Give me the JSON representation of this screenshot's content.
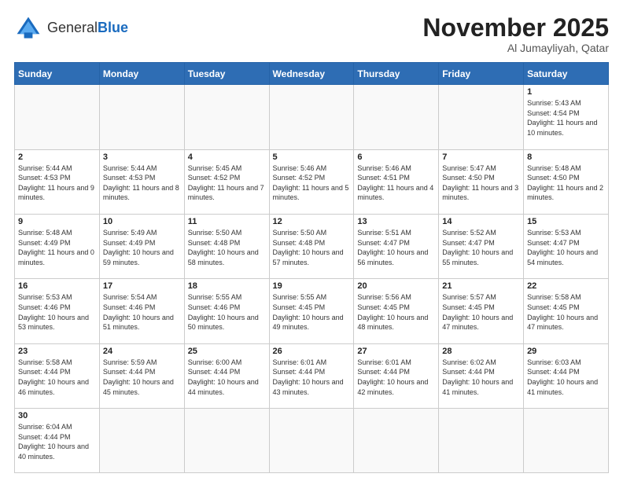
{
  "header": {
    "logo_general": "General",
    "logo_blue": "Blue",
    "month_title": "November 2025",
    "location": "Al Jumayliyah, Qatar"
  },
  "weekdays": [
    "Sunday",
    "Monday",
    "Tuesday",
    "Wednesday",
    "Thursday",
    "Friday",
    "Saturday"
  ],
  "weeks": [
    [
      {
        "day": "",
        "info": ""
      },
      {
        "day": "",
        "info": ""
      },
      {
        "day": "",
        "info": ""
      },
      {
        "day": "",
        "info": ""
      },
      {
        "day": "",
        "info": ""
      },
      {
        "day": "",
        "info": ""
      },
      {
        "day": "1",
        "info": "Sunrise: 5:43 AM\nSunset: 4:54 PM\nDaylight: 11 hours and 10 minutes."
      }
    ],
    [
      {
        "day": "2",
        "info": "Sunrise: 5:44 AM\nSunset: 4:53 PM\nDaylight: 11 hours and 9 minutes."
      },
      {
        "day": "3",
        "info": "Sunrise: 5:44 AM\nSunset: 4:53 PM\nDaylight: 11 hours and 8 minutes."
      },
      {
        "day": "4",
        "info": "Sunrise: 5:45 AM\nSunset: 4:52 PM\nDaylight: 11 hours and 7 minutes."
      },
      {
        "day": "5",
        "info": "Sunrise: 5:46 AM\nSunset: 4:52 PM\nDaylight: 11 hours and 5 minutes."
      },
      {
        "day": "6",
        "info": "Sunrise: 5:46 AM\nSunset: 4:51 PM\nDaylight: 11 hours and 4 minutes."
      },
      {
        "day": "7",
        "info": "Sunrise: 5:47 AM\nSunset: 4:50 PM\nDaylight: 11 hours and 3 minutes."
      },
      {
        "day": "8",
        "info": "Sunrise: 5:48 AM\nSunset: 4:50 PM\nDaylight: 11 hours and 2 minutes."
      }
    ],
    [
      {
        "day": "9",
        "info": "Sunrise: 5:48 AM\nSunset: 4:49 PM\nDaylight: 11 hours and 0 minutes."
      },
      {
        "day": "10",
        "info": "Sunrise: 5:49 AM\nSunset: 4:49 PM\nDaylight: 10 hours and 59 minutes."
      },
      {
        "day": "11",
        "info": "Sunrise: 5:50 AM\nSunset: 4:48 PM\nDaylight: 10 hours and 58 minutes."
      },
      {
        "day": "12",
        "info": "Sunrise: 5:50 AM\nSunset: 4:48 PM\nDaylight: 10 hours and 57 minutes."
      },
      {
        "day": "13",
        "info": "Sunrise: 5:51 AM\nSunset: 4:47 PM\nDaylight: 10 hours and 56 minutes."
      },
      {
        "day": "14",
        "info": "Sunrise: 5:52 AM\nSunset: 4:47 PM\nDaylight: 10 hours and 55 minutes."
      },
      {
        "day": "15",
        "info": "Sunrise: 5:53 AM\nSunset: 4:47 PM\nDaylight: 10 hours and 54 minutes."
      }
    ],
    [
      {
        "day": "16",
        "info": "Sunrise: 5:53 AM\nSunset: 4:46 PM\nDaylight: 10 hours and 53 minutes."
      },
      {
        "day": "17",
        "info": "Sunrise: 5:54 AM\nSunset: 4:46 PM\nDaylight: 10 hours and 51 minutes."
      },
      {
        "day": "18",
        "info": "Sunrise: 5:55 AM\nSunset: 4:46 PM\nDaylight: 10 hours and 50 minutes."
      },
      {
        "day": "19",
        "info": "Sunrise: 5:55 AM\nSunset: 4:45 PM\nDaylight: 10 hours and 49 minutes."
      },
      {
        "day": "20",
        "info": "Sunrise: 5:56 AM\nSunset: 4:45 PM\nDaylight: 10 hours and 48 minutes."
      },
      {
        "day": "21",
        "info": "Sunrise: 5:57 AM\nSunset: 4:45 PM\nDaylight: 10 hours and 47 minutes."
      },
      {
        "day": "22",
        "info": "Sunrise: 5:58 AM\nSunset: 4:45 PM\nDaylight: 10 hours and 47 minutes."
      }
    ],
    [
      {
        "day": "23",
        "info": "Sunrise: 5:58 AM\nSunset: 4:44 PM\nDaylight: 10 hours and 46 minutes."
      },
      {
        "day": "24",
        "info": "Sunrise: 5:59 AM\nSunset: 4:44 PM\nDaylight: 10 hours and 45 minutes."
      },
      {
        "day": "25",
        "info": "Sunrise: 6:00 AM\nSunset: 4:44 PM\nDaylight: 10 hours and 44 minutes."
      },
      {
        "day": "26",
        "info": "Sunrise: 6:01 AM\nSunset: 4:44 PM\nDaylight: 10 hours and 43 minutes."
      },
      {
        "day": "27",
        "info": "Sunrise: 6:01 AM\nSunset: 4:44 PM\nDaylight: 10 hours and 42 minutes."
      },
      {
        "day": "28",
        "info": "Sunrise: 6:02 AM\nSunset: 4:44 PM\nDaylight: 10 hours and 41 minutes."
      },
      {
        "day": "29",
        "info": "Sunrise: 6:03 AM\nSunset: 4:44 PM\nDaylight: 10 hours and 41 minutes."
      }
    ],
    [
      {
        "day": "30",
        "info": "Sunrise: 6:04 AM\nSunset: 4:44 PM\nDaylight: 10 hours and 40 minutes."
      },
      {
        "day": "",
        "info": ""
      },
      {
        "day": "",
        "info": ""
      },
      {
        "day": "",
        "info": ""
      },
      {
        "day": "",
        "info": ""
      },
      {
        "day": "",
        "info": ""
      },
      {
        "day": "",
        "info": ""
      }
    ]
  ]
}
